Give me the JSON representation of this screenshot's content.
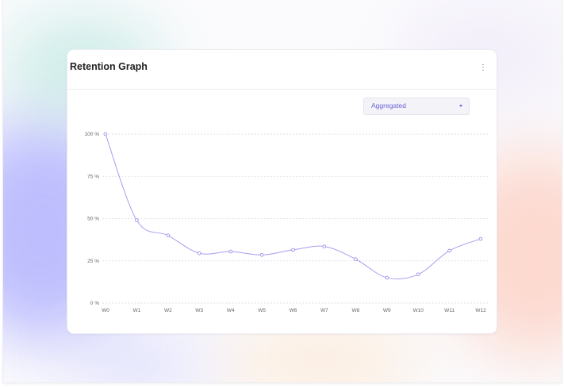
{
  "card": {
    "title": "Retention Graph",
    "menu_icon": "kebab-menu-icon"
  },
  "filter": {
    "selected": "Aggregated",
    "icon": "chevron-down-icon"
  },
  "colors": {
    "accent": "#6b63d6",
    "line": "#a89df0"
  },
  "chart_data": {
    "type": "line",
    "title": "Retention Graph",
    "categories": [
      "W0",
      "W1",
      "W2",
      "W3",
      "W4",
      "W5",
      "W6",
      "W7",
      "W8",
      "W9",
      "W10",
      "W11",
      "W12"
    ],
    "values": [
      100,
      49,
      40,
      29.5,
      30.5,
      28.5,
      31.5,
      33.5,
      26,
      15,
      17,
      31,
      38
    ],
    "ylim": [
      0,
      100
    ],
    "yticks": [
      0,
      25,
      50,
      75,
      100
    ],
    "ytick_labels": [
      "0 %",
      "25 %",
      "50 %",
      "75 %",
      "100 %"
    ],
    "xlabel": "",
    "ylabel": "",
    "grid": true,
    "legend": "none",
    "markers": "hollow-circle"
  }
}
